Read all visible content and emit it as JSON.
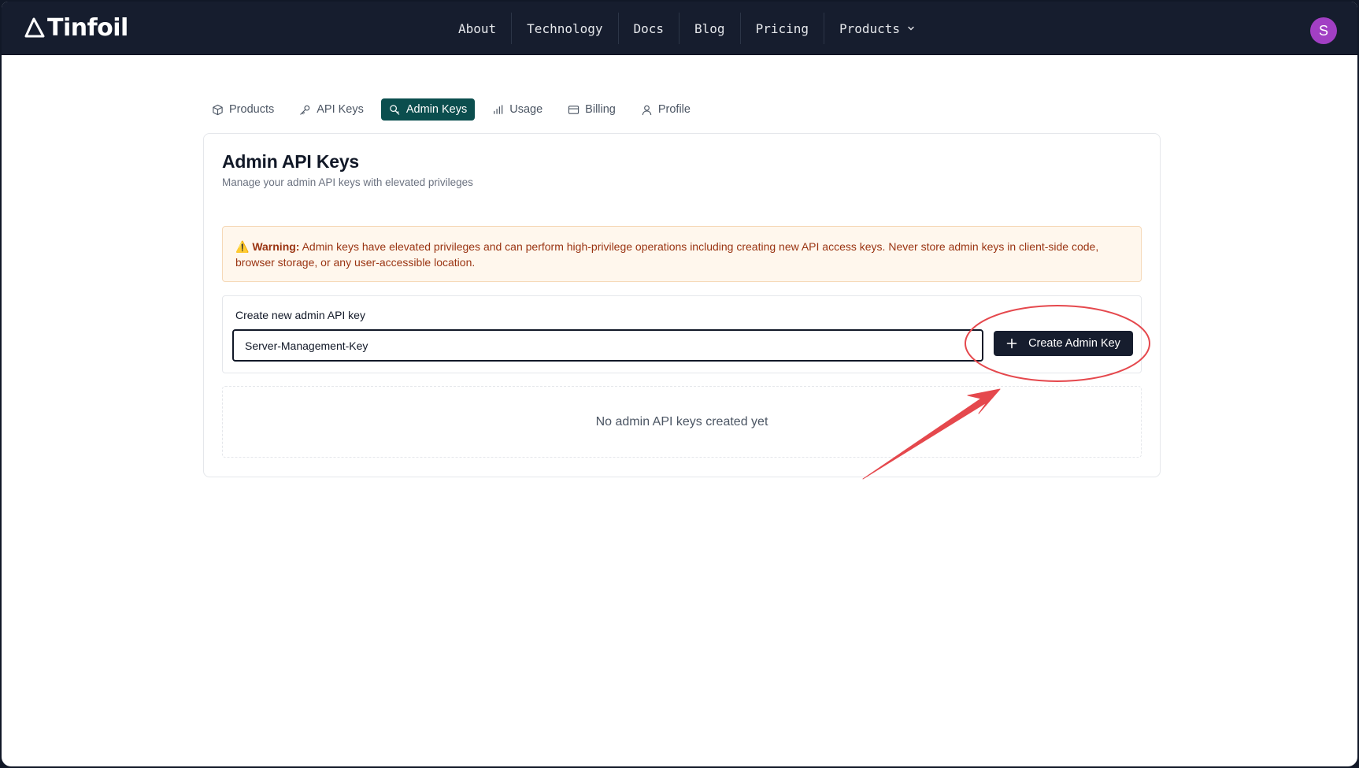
{
  "brand": {
    "name": "Tinfoil",
    "logo_icon": "triangle-logo-icon"
  },
  "nav": {
    "links": [
      {
        "label": "About"
      },
      {
        "label": "Technology"
      },
      {
        "label": "Docs"
      },
      {
        "label": "Blog"
      },
      {
        "label": "Pricing"
      },
      {
        "label": "Products",
        "icon": "chevron-down-icon"
      }
    ],
    "avatar_initial": "S",
    "avatar_color": "#a23fc4"
  },
  "tabs": [
    {
      "label": "Products",
      "icon": "box-icon",
      "active": false
    },
    {
      "label": "API Keys",
      "icon": "key-icon",
      "active": false
    },
    {
      "label": "Admin Keys",
      "icon": "admin-key-icon",
      "active": true
    },
    {
      "label": "Usage",
      "icon": "bar-chart-icon",
      "active": false
    },
    {
      "label": "Billing",
      "icon": "credit-card-icon",
      "active": false
    },
    {
      "label": "Profile",
      "icon": "user-icon",
      "active": false
    }
  ],
  "card": {
    "title": "Admin API Keys",
    "subtitle": "Manage your admin API keys with elevated privileges",
    "warning": {
      "emoji": "⚠️",
      "label": "Warning:",
      "text": "Admin keys have elevated privileges and can perform high-privilege operations including creating new API access keys. Never store admin keys in client-side code, browser storage, or any user-accessible location."
    },
    "create": {
      "label": "Create new admin API key",
      "input_value": "Server-Management-Key",
      "button_label": "Create Admin Key"
    },
    "empty_message": "No admin API keys created yet"
  },
  "colors": {
    "nav_bg": "#161d2e",
    "active_tab": "#0b4e4e",
    "warning_bg": "#fff7ed",
    "warning_text": "#9a3412",
    "annotation": "#e5484d"
  }
}
